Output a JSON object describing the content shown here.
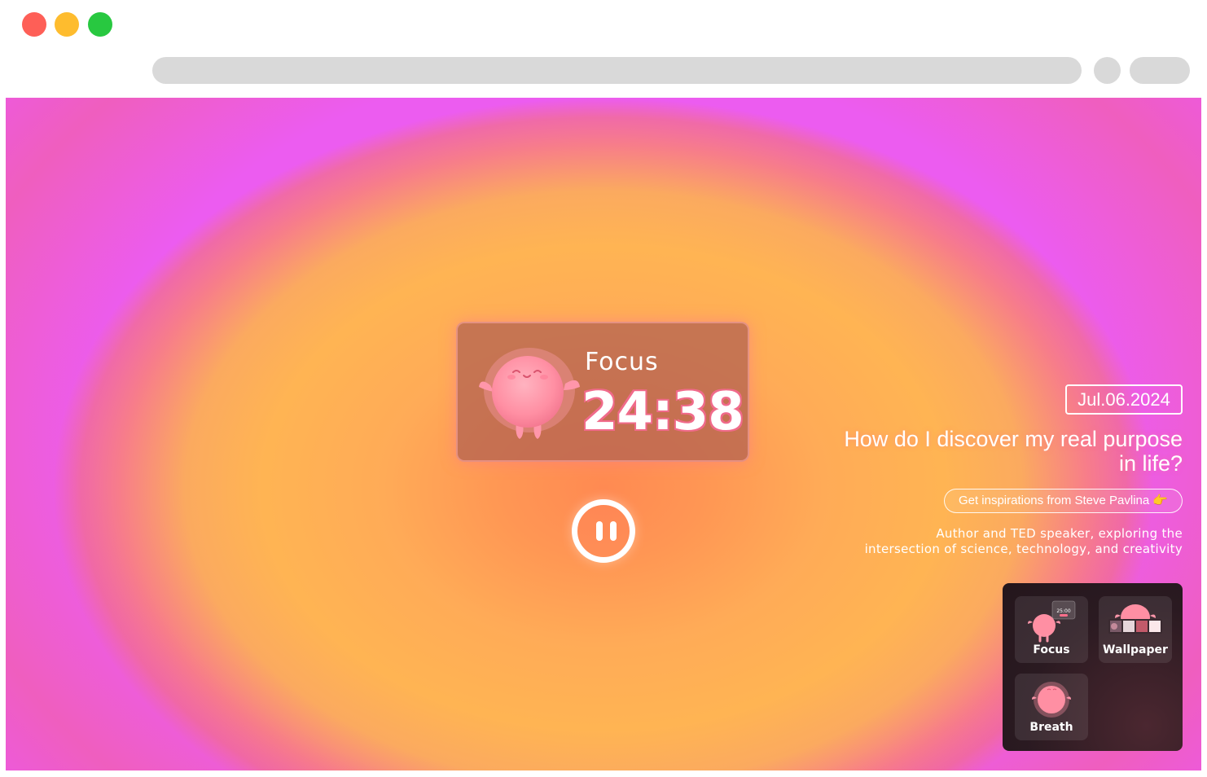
{
  "browser": {
    "traffic_lights": [
      "#fe5f57",
      "#febc2e",
      "#28c840"
    ]
  },
  "timer": {
    "label": "Focus",
    "value": "24:38",
    "state_icon": "pause-icon"
  },
  "info": {
    "date": "Jul.06.2024",
    "quote": "How do I discover my real purpose in life?",
    "link_text": "Get inspirations from Steve Pavlina 👉",
    "author_desc_line1": "Author and TED speaker, exploring the",
    "author_desc_line2": "intersection of science, technology, and creativity"
  },
  "apps": [
    {
      "label": "Focus",
      "icon": "focus-app-icon",
      "mini_timer": "25:00"
    },
    {
      "label": "Wallpaper",
      "icon": "wallpaper-app-icon"
    },
    {
      "label": "Breath",
      "icon": "breath-app-icon"
    }
  ],
  "colors": {
    "background_center": "#ff8a52",
    "background_mid": "#ffb453",
    "background_edge": "#ec5cf0",
    "mascot": "#ff8fa3",
    "accent": "#f06a8a"
  }
}
